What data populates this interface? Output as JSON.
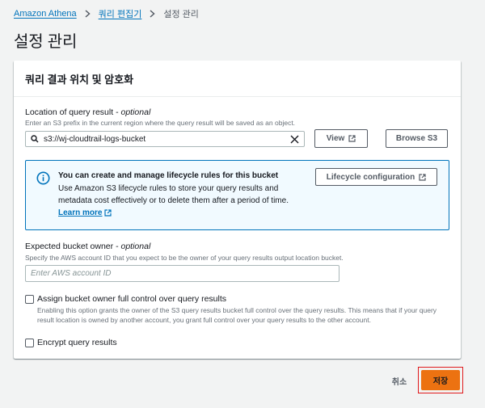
{
  "breadcrumb": {
    "items": [
      "Amazon Athena",
      "쿼리 편집기"
    ],
    "current": "설정 관리"
  },
  "page": {
    "title": "설정 관리"
  },
  "panel": {
    "title": "쿼리 결과 위치 및 암호화",
    "query_result": {
      "label": "Location of query result",
      "label_suffix": "optional",
      "description": "Enter an S3 prefix in the current region where the query result will be saved as an object.",
      "value": "s3://wj-cloudtrail-logs-bucket",
      "view_button": "View",
      "browse_button": "Browse S3"
    },
    "info": {
      "title": "You can create and manage lifecycle rules for this bucket",
      "body": "Use Amazon S3 lifecycle rules to store your query results and metadata cost effectively or to delete them after a period of time.",
      "learn_more": "Learn more",
      "lifecycle_button": "Lifecycle configuration"
    },
    "bucket_owner": {
      "label": "Expected bucket owner",
      "label_suffix": "optional",
      "description": "Specify the AWS account ID that you expect to be the owner of your query results output location bucket.",
      "placeholder": "Enter AWS account ID"
    },
    "full_control": {
      "label": "Assign bucket owner full control over query results",
      "description": "Enabling this option grants the owner of the S3 query results bucket full control over the query results. This means that if your query result location is owned by another account, you grant full control over your query results to the other account.",
      "checked": false
    },
    "encrypt": {
      "label": "Encrypt query results",
      "checked": false
    }
  },
  "footer": {
    "cancel": "취소",
    "save": "저장"
  },
  "colors": {
    "link": "#0073bb",
    "primary": "#ec7211",
    "highlight": "#e0191c",
    "info_bg": "#f1faff"
  }
}
